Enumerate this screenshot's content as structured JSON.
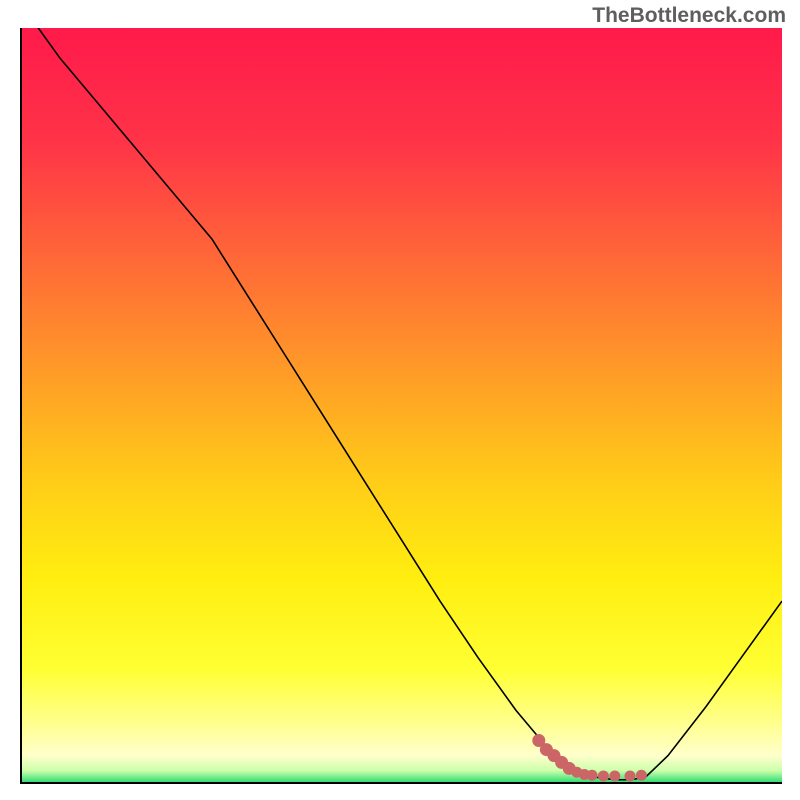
{
  "watermark": "TheBottleneck.com",
  "chart_data": {
    "type": "line",
    "title": "",
    "xlabel": "",
    "ylabel": "",
    "xlim": [
      0,
      100
    ],
    "ylim": [
      0,
      100
    ],
    "x": [
      0,
      5,
      10,
      15,
      20,
      25,
      30,
      35,
      40,
      45,
      50,
      55,
      60,
      65,
      70,
      72,
      75,
      78,
      80,
      82,
      85,
      90,
      95,
      100
    ],
    "values": [
      103,
      96,
      90,
      84,
      78,
      72,
      64,
      56,
      48,
      40,
      32,
      24,
      16.5,
      9.5,
      3.5,
      1.8,
      0.7,
      0.3,
      0.3,
      0.6,
      3.5,
      10,
      17,
      24
    ],
    "minimum_x": 78,
    "minimum_y": 0.3,
    "highlight_points": [
      {
        "x": 68,
        "y": 5.5
      },
      {
        "x": 69,
        "y": 4.3
      },
      {
        "x": 70,
        "y": 3.5
      },
      {
        "x": 71,
        "y": 2.6
      },
      {
        "x": 72,
        "y": 1.8
      },
      {
        "x": 73,
        "y": 1.3
      },
      {
        "x": 74,
        "y": 1.0
      },
      {
        "x": 75,
        "y": 0.9
      },
      {
        "x": 76.5,
        "y": 0.8
      },
      {
        "x": 78,
        "y": 0.8
      },
      {
        "x": 80,
        "y": 0.8
      },
      {
        "x": 81.5,
        "y": 0.9
      }
    ],
    "highlight_color": "#cc6666",
    "gradient_stops": [
      {
        "pos": 0,
        "color": "#ff1a4a"
      },
      {
        "pos": 15,
        "color": "#ff3348"
      },
      {
        "pos": 30,
        "color": "#ff6638"
      },
      {
        "pos": 45,
        "color": "#ff9928"
      },
      {
        "pos": 60,
        "color": "#ffcc18"
      },
      {
        "pos": 73,
        "color": "#ffee10"
      },
      {
        "pos": 85,
        "color": "#ffff33"
      },
      {
        "pos": 93,
        "color": "#ffff99"
      },
      {
        "pos": 96.5,
        "color": "#ffffcc"
      },
      {
        "pos": 98.5,
        "color": "#ccffaa"
      },
      {
        "pos": 100,
        "color": "#33dd77"
      }
    ]
  }
}
